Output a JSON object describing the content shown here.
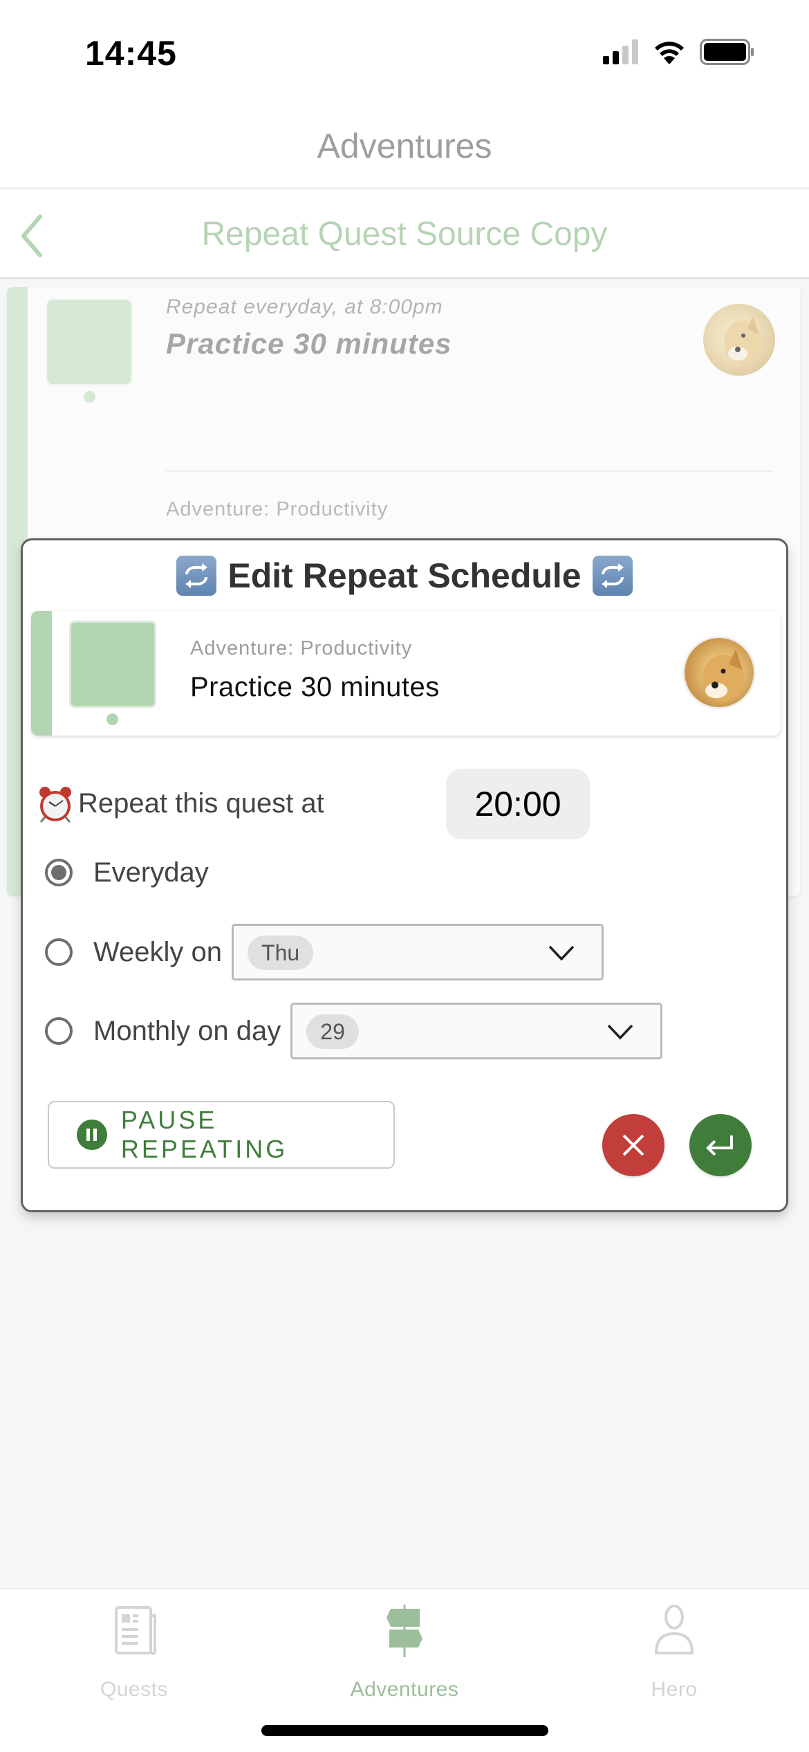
{
  "status_bar": {
    "time": "14:45",
    "signal_icon": "cellular-signal-icon",
    "wifi_icon": "wifi-icon",
    "battery_icon": "battery-icon"
  },
  "app_header": {
    "title": "Adventures"
  },
  "nav_bar": {
    "back_icon": "chevron-left-icon",
    "title": "Repeat Quest Source Copy"
  },
  "background_quest_card": {
    "repeat_text": "Repeat everyday, at 8:00pm",
    "title": "Practice 30 minutes",
    "adventure": "Adventure: Productivity",
    "avatar": "doge-avatar"
  },
  "modal": {
    "title": "Edit Repeat Schedule",
    "title_icon": "repeat-icon",
    "quest_card": {
      "adventure": "Adventure: Productivity",
      "title": "Practice 30 minutes",
      "avatar": "doge-avatar"
    },
    "time_row": {
      "icon": "alarm-clock-icon",
      "label": "Repeat this quest at",
      "time_value": "20:00"
    },
    "options": [
      {
        "label": "Everyday",
        "selected": true
      },
      {
        "label": "Weekly on",
        "selected": false,
        "select_value": "Thu"
      },
      {
        "label": "Monthly on day",
        "selected": false,
        "select_value": "29"
      }
    ],
    "pause_button": {
      "label": "PAUSE REPEATING",
      "icon": "pause-icon"
    },
    "cancel_button": {
      "icon": "close-icon"
    },
    "confirm_button": {
      "icon": "enter-return-icon"
    },
    "colors": {
      "primary_green": "#3f7d3a",
      "danger_red": "#c23e3a",
      "accent_light_green": "#b1d5b0"
    }
  },
  "tab_bar": {
    "tabs": [
      {
        "label": "Quests",
        "icon": "newspaper-icon",
        "active": false
      },
      {
        "label": "Adventures",
        "icon": "signpost-icon",
        "active": true
      },
      {
        "label": "Hero",
        "icon": "person-icon",
        "active": false
      }
    ]
  }
}
